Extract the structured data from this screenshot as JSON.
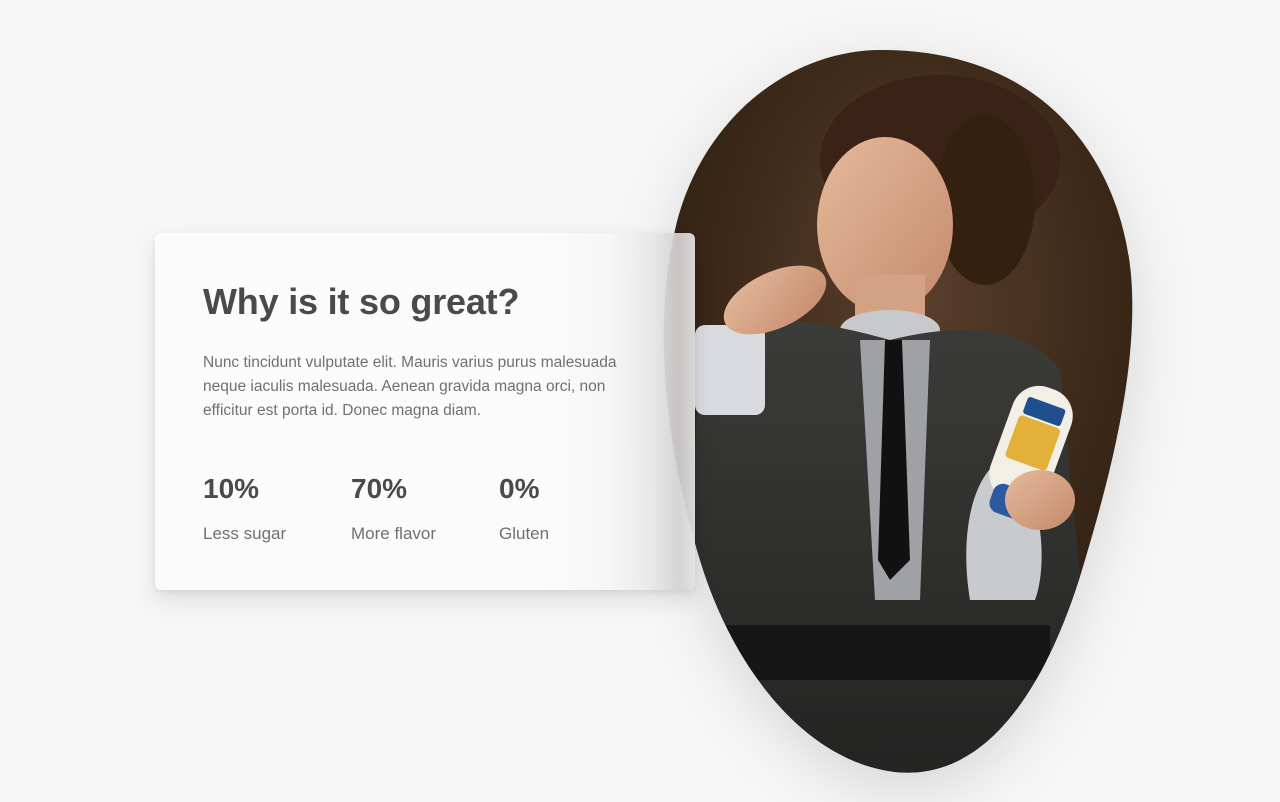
{
  "section": {
    "title": "Why is it so great?",
    "description": "Nunc tincidunt vulputate elit. Mauris varius purus malesuada neque iaculis malesuada. Aenean gravida magna orci, non efficitur est porta id. Donec magna diam.",
    "stats": [
      {
        "value": "10%",
        "label": "Less sugar"
      },
      {
        "value": "70%",
        "label": "More flavor"
      },
      {
        "value": "0%",
        "label": "Gluten"
      }
    ]
  },
  "image": {
    "subject": "woman-tasting-mayonnaise-photo"
  },
  "colors": {
    "background": "#f6f6f6",
    "card": "#fbfbfb",
    "heading": "#4a4a4a",
    "body_text": "#707070"
  }
}
